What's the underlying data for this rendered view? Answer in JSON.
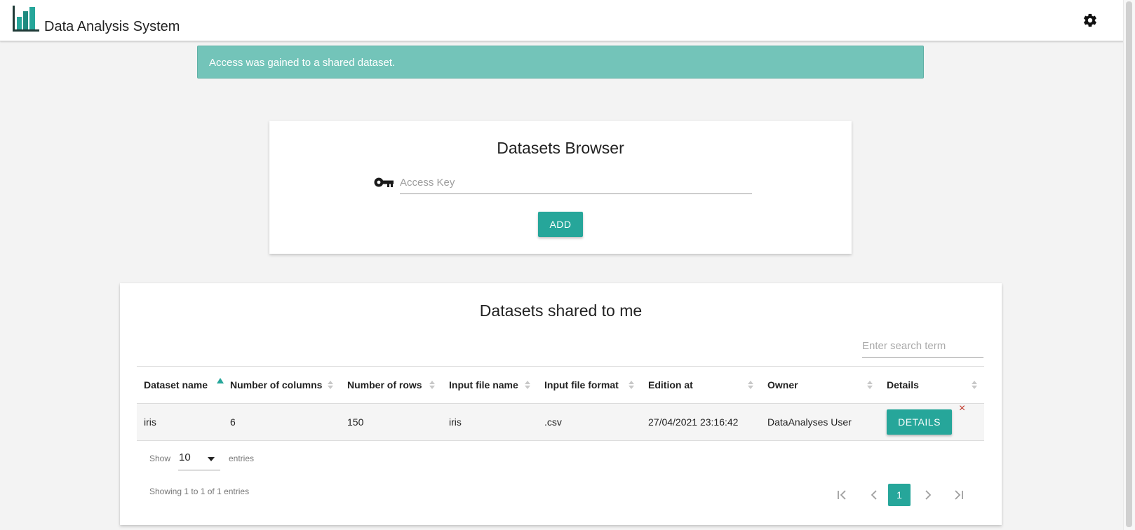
{
  "app": {
    "title": "Data Analysis System"
  },
  "alert": {
    "message": "Access was gained to a shared dataset."
  },
  "browser": {
    "title": "Datasets Browser",
    "access_key_placeholder": "Access Key",
    "add_label": "ADD"
  },
  "shared": {
    "title": "Datasets shared to me",
    "search_placeholder": "Enter search term",
    "columns": [
      "Dataset name",
      "Number of columns",
      "Number of rows",
      "Input file name",
      "Input file format",
      "Edition at",
      "Owner",
      "Details"
    ],
    "sorted_column": "Dataset name",
    "sort_direction": "ascending",
    "rows": [
      {
        "dataset_name": "iris",
        "number_of_columns": "6",
        "number_of_rows": "150",
        "input_file_name": "iris",
        "input_file_format": ".csv",
        "edition_at": "27/04/2021 23:16:42",
        "owner": "DataAnalyses User",
        "details_label": "DETAILS",
        "remove_icon": "×"
      }
    ],
    "show_label": "Show",
    "entries_value": "10",
    "entries_label": "entries",
    "info": "Showing 1 to 1 of 1 entries",
    "current_page": "1"
  },
  "icons": {
    "logo": "bar-chart-logo-icon",
    "settings": "gear-icon",
    "key": "key-icon"
  },
  "colors": {
    "accent": "#26a69a",
    "alert_bg": "#73c4b9",
    "remove": "#c0392b"
  }
}
